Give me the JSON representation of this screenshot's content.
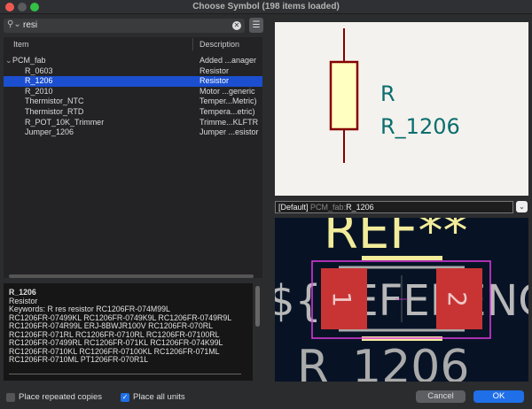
{
  "window": {
    "title": "Choose Symbol (198 items loaded)"
  },
  "search": {
    "value": "resi",
    "icon": "search-icon",
    "clear_icon": "clear-icon",
    "sort_icon": "sort-icon"
  },
  "tree": {
    "columns": [
      "Item",
      "Description"
    ],
    "rows": [
      {
        "item": "PCM_fab",
        "desc": "Added ...anager",
        "group": true
      },
      {
        "item": "R_0603",
        "desc": "Resistor"
      },
      {
        "item": "R_1206",
        "desc": "Resistor",
        "selected": true
      },
      {
        "item": "R_2010",
        "desc": "Motor ...generic"
      },
      {
        "item": "Thermistor_NTC",
        "desc": "Temper...Metric)"
      },
      {
        "item": "Thermistor_RTD",
        "desc": "Tempera...etric)"
      },
      {
        "item": "R_POT_10K_Trimmer",
        "desc": "Trimme...KLFTR"
      },
      {
        "item": "Jumper_1206",
        "desc": "Jumper ...esistor"
      }
    ]
  },
  "details": {
    "name": "R_1206",
    "description": "Resistor",
    "keywords_lines": [
      "Keywords: R res resistor RC1206FR-074M99L",
      "RC1206FR-07499KL RC1206FR-0749K9L RC1206FR-0749R9L",
      "RC1206FR-074R99L ERJ-8BWJR100V RC1206FR-070RL",
      "RC1206FR-071RL RC1206FR-0710RL RC1206FR-07100RL",
      "RC1206FR-07499RL RC1206FR-071KL RC1206FR-074K99L",
      "RC1206FR-0710KL RC1206FR-07100KL RC1206FR-071ML",
      "RC1206FR-0710ML PT1206FR-070R1L"
    ]
  },
  "options": {
    "place_repeated": {
      "label": "Place repeated copies",
      "checked": false
    },
    "place_all_units": {
      "label": "Place all units",
      "checked": true
    }
  },
  "symbol_preview": {
    "reference": "R",
    "value": "R_1206"
  },
  "footprint": {
    "selector_prefix": "[Default]",
    "selector_lib": "PCM_fab:",
    "selector_name": "R_1206",
    "ref_text": "REF**",
    "fab_text": "${REFERENCE}",
    "value_text": "R_1206",
    "pad1": "1",
    "pad2": "2"
  },
  "buttons": {
    "cancel": "Cancel",
    "ok": "OK"
  },
  "colors": {
    "accent": "#1b4fd0",
    "ok": "#1f6fe8",
    "pad": "#c83434",
    "silk": "#f2eb9a",
    "courtyard": "#e23ae0",
    "symbol_body": "#840000",
    "symbol_fill": "#ffffc2",
    "symbol_text": "#0a6e6e"
  }
}
